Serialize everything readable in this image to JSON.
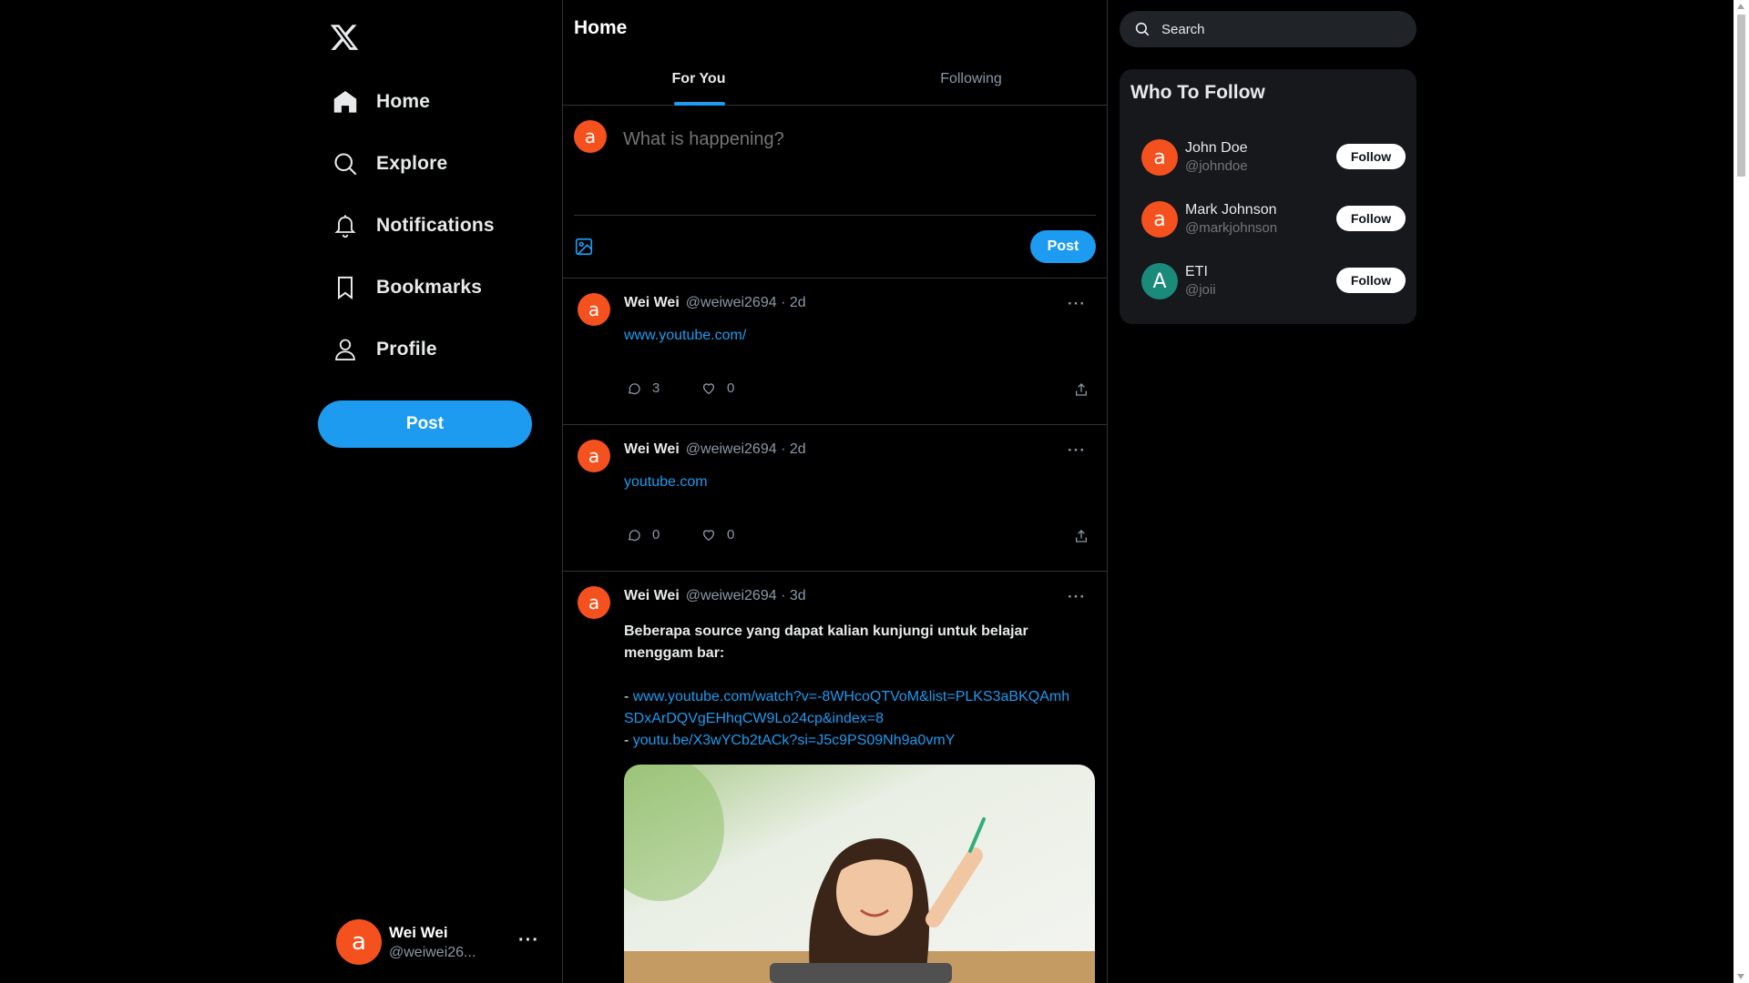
{
  "sidebar": {
    "logo": "x-logo-icon",
    "items": [
      {
        "label": "Home",
        "icon": "home-icon",
        "active": true
      },
      {
        "label": "Explore",
        "icon": "search-icon"
      },
      {
        "label": "Notifications",
        "icon": "bell-icon"
      },
      {
        "label": "Bookmarks",
        "icon": "bookmark-icon"
      },
      {
        "label": "Profile",
        "icon": "user-icon"
      }
    ],
    "post_label": "Post",
    "account": {
      "avatar_letter": "a",
      "name": "Wei Wei",
      "handle": "@weiwei26...",
      "more": "···"
    }
  },
  "main": {
    "title": "Home",
    "tabs": [
      {
        "label": "For You",
        "active": true
      },
      {
        "label": "Following"
      }
    ],
    "composer": {
      "avatar_letter": "a",
      "placeholder": "What is happening?",
      "post_label": "Post"
    },
    "tweets": [
      {
        "avatar_letter": "a",
        "name": "Wei Wei",
        "handle_time": "@weiwei2694 · 2d",
        "link": "www.youtube.com/",
        "replies": "3",
        "likes": "0"
      },
      {
        "avatar_letter": "a",
        "name": "Wei Wei",
        "handle_time": "@weiwei2694 · 2d",
        "link": "youtube.com",
        "replies": "0",
        "likes": "0"
      },
      {
        "avatar_letter": "a",
        "name": "Wei Wei",
        "handle_time": "@weiwei2694 · 3d",
        "text": "Beberapa source yang dapat kalian kunjungi untuk belajar menggam bar:",
        "dash": "- ",
        "link1": "www.youtube.com/watch?v=-8WHcoQTVoM&list=PLKS3aBKQAmhSDxArDQVgEHhqCW9Lo24cp&index=8",
        "link2": "youtu.be/X3wYCb2tACk?si=J5c9PS09Nh9a0vmY"
      }
    ]
  },
  "right": {
    "search_placeholder": "Search",
    "who_to_follow": {
      "title": "Who To Follow",
      "users": [
        {
          "avatar_letter": "a",
          "name": "John Doe",
          "handle": "@johndoe",
          "color": "#f4511e",
          "button": "Follow"
        },
        {
          "avatar_letter": "a",
          "name": "Mark Johnson",
          "handle": "@markjohnson",
          "color": "#f4511e",
          "button": "Follow"
        },
        {
          "avatar_letter": "A",
          "name": "ETI",
          "handle": "@joii",
          "color": "#1a8a7a",
          "button": "Follow"
        }
      ]
    }
  },
  "colors": {
    "accent": "#1d9bf0",
    "avatar": "#f4511e",
    "background": "#000000"
  }
}
